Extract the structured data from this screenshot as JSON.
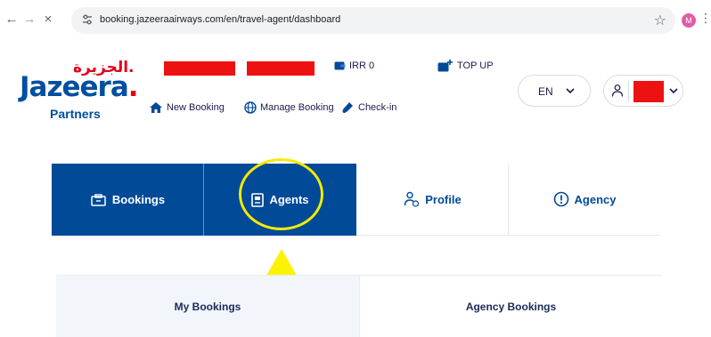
{
  "browser": {
    "url": "booking.jazeeraairways.com/en/travel-agent/dashboard",
    "profile_initial": "M"
  },
  "logo": {
    "arabic": "الجزيرة.",
    "english": "Jazeera",
    "english_dot": ".",
    "tagline": "Partners"
  },
  "header": {
    "balance": "IRR 0",
    "topup": "TOP UP",
    "new_booking": "New Booking",
    "manage_booking": "Manage Booking",
    "checkin": "Check-in",
    "language": "EN"
  },
  "tabs": [
    {
      "label": "Bookings"
    },
    {
      "label": "Agents"
    },
    {
      "label": "Profile"
    },
    {
      "label": "Agency"
    }
  ],
  "subtabs": [
    {
      "label": "My Bookings"
    },
    {
      "label": "Agency Bookings"
    }
  ],
  "colors": {
    "brand_blue": "#004a98",
    "brand_red": "#e2001a",
    "highlight_yellow": "#f6ea00",
    "redaction": "#ee1111"
  }
}
